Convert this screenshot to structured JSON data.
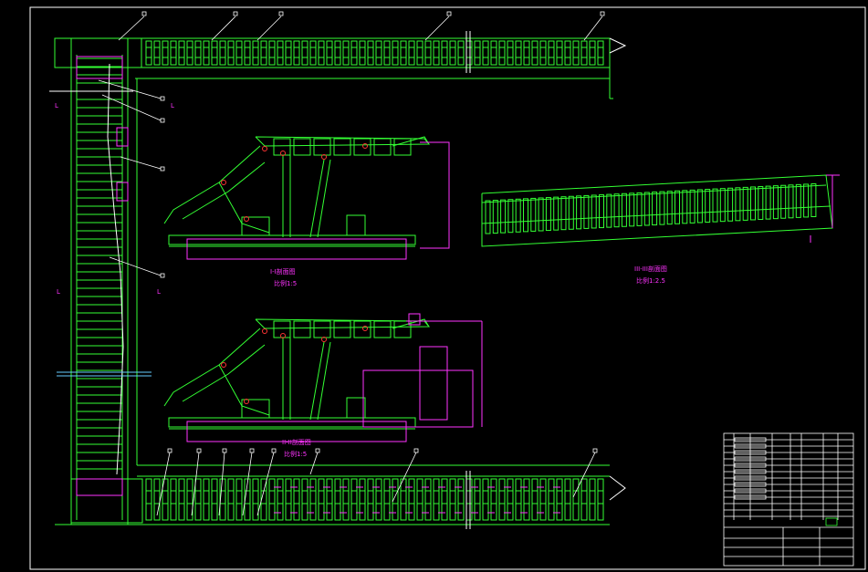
{
  "colors": {
    "background": "#000000",
    "green": "#33ff33",
    "magenta": "#ff33ff",
    "white": "#ffffff",
    "cyan": "#66ccff",
    "red": "#ff3333"
  },
  "views": {
    "section_1": {
      "title": "I-I剖面图",
      "scale": "比例1:5"
    },
    "section_2": {
      "title": "II-II剖面图",
      "scale": "比例1:5"
    },
    "section_3": {
      "title": "III-III剖面图",
      "scale": "比例1:2.5"
    }
  },
  "section_marks": {
    "a_left": "L",
    "a_right": "L",
    "b_left": "L",
    "b_right": "L"
  }
}
